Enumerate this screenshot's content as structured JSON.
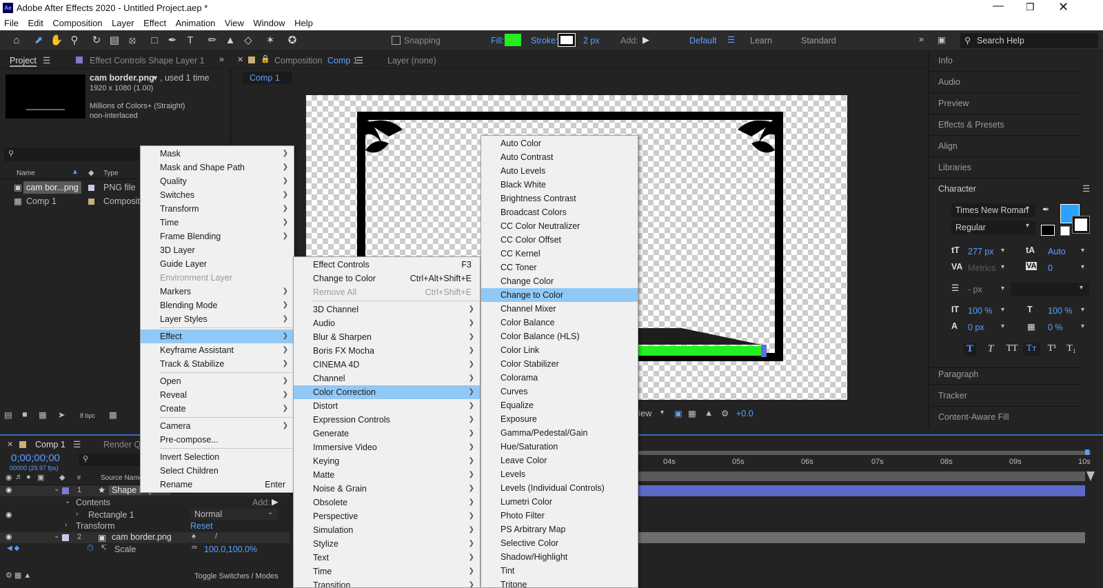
{
  "title": "Adobe After Effects 2020 - Untitled Project.aep *",
  "menubar": [
    "File",
    "Edit",
    "Composition",
    "Layer",
    "Effect",
    "Animation",
    "View",
    "Window",
    "Help"
  ],
  "toolbar": {
    "snapping": "Snapping",
    "fill_label": "Fill:",
    "fill_color": "#22ee22",
    "stroke_label": "Stroke:",
    "stroke_px": "2 px",
    "add_label": "Add:",
    "workspace_default": "Default",
    "workspace_learn": "Learn",
    "workspace_standard": "Standard",
    "search_placeholder": "Search Help"
  },
  "project": {
    "tab_project": "Project",
    "tab_effect_controls": "Effect Controls Shape Layer 1",
    "asset_name": "cam border.png",
    "asset_used": ", used 1 time",
    "asset_dims": "1920 x 1080 (1.00)",
    "asset_colors": "Millions of Colors+ (Straight)",
    "asset_interlace": "non-interlaced",
    "col_name": "Name",
    "col_type": "Type",
    "items": [
      {
        "name": "cam bor...png",
        "type": "PNG file"
      },
      {
        "name": "Comp 1",
        "type": "Composit"
      }
    ],
    "bpc": "8 bpc"
  },
  "composition": {
    "tab_label": "Composition",
    "tab_comp": "Comp 1",
    "layer_tab": "Layer  (none)",
    "sub_tab": "Comp 1",
    "view_label": "1 View",
    "exposure": "+0.0"
  },
  "right_panel": {
    "items_top": [
      "Info",
      "Audio",
      "Preview",
      "Effects & Presets",
      "Align",
      "Libraries"
    ],
    "character": "Character",
    "font": "Times New Roman",
    "style": "Regular",
    "size": "277 px",
    "leading": "Auto",
    "kerning": "Metrics",
    "tracking": "0",
    "stroke_px": "- px",
    "vscale": "100 %",
    "hscale": "100 %",
    "baseline": "0 px",
    "tsume": "0 %",
    "fill_swatch": "#29a3ff",
    "items_bottom": [
      "Paragraph",
      "Tracker",
      "Content-Aware Fill"
    ]
  },
  "timeline": {
    "tab_comp": "Comp 1",
    "tab_render": "Render Qu",
    "timecode": "0;00;00;00",
    "fps": "00000 (29.97 fps)",
    "source_name": "Source Name",
    "layers": [
      {
        "num": "1",
        "name": "Shape Layer 1"
      },
      {
        "num": "2",
        "name": "cam border.png"
      }
    ],
    "contents": "Contents",
    "add": "Add:",
    "rectangle": "Rectangle 1",
    "blend_mode": "Normal",
    "transform": "Transform",
    "reset": "Reset",
    "scale_label": "Scale",
    "scale_value": "100.0,100.0%",
    "ruler": [
      "04s",
      "05s",
      "06s",
      "07s",
      "08s",
      "09s",
      "10s"
    ],
    "toggle": "Toggle Switches / Modes"
  },
  "context_menu": [
    {
      "label": "Mask",
      "sub": true
    },
    {
      "label": "Mask and Shape Path",
      "sub": true
    },
    {
      "label": "Quality",
      "sub": true
    },
    {
      "label": "Switches",
      "sub": true
    },
    {
      "label": "Transform",
      "sub": true
    },
    {
      "label": "Time",
      "sub": true
    },
    {
      "label": "Frame Blending",
      "sub": true
    },
    {
      "label": "3D Layer"
    },
    {
      "label": "Guide Layer"
    },
    {
      "label": "Environment Layer",
      "disabled": true
    },
    {
      "label": "Markers",
      "sub": true
    },
    {
      "label": "Blending Mode",
      "sub": true
    },
    {
      "label": "Layer Styles",
      "sub": true
    },
    {
      "sep": true
    },
    {
      "label": "Effect",
      "sub": true,
      "highlight": true
    },
    {
      "label": "Keyframe Assistant",
      "sub": true
    },
    {
      "label": "Track & Stabilize",
      "sub": true
    },
    {
      "sep": true
    },
    {
      "label": "Open",
      "sub": true
    },
    {
      "label": "Reveal",
      "sub": true
    },
    {
      "label": "Create",
      "sub": true
    },
    {
      "sep": true
    },
    {
      "label": "Camera",
      "sub": true
    },
    {
      "label": "Pre-compose..."
    },
    {
      "sep": true
    },
    {
      "label": "Invert Selection"
    },
    {
      "label": "Select Children"
    },
    {
      "label": "Rename",
      "shortcut": "Enter"
    }
  ],
  "effect_menu": [
    {
      "label": "Effect Controls",
      "shortcut": "F3"
    },
    {
      "label": "Change to Color",
      "shortcut": "Ctrl+Alt+Shift+E"
    },
    {
      "label": "Remove All",
      "shortcut": "Ctrl+Shift+E",
      "disabled": true
    },
    {
      "sep": true
    },
    {
      "label": "3D Channel",
      "sub": true
    },
    {
      "label": "Audio",
      "sub": true
    },
    {
      "label": "Blur & Sharpen",
      "sub": true
    },
    {
      "label": "Boris FX Mocha",
      "sub": true
    },
    {
      "label": "CINEMA 4D",
      "sub": true
    },
    {
      "label": "Channel",
      "sub": true
    },
    {
      "label": "Color Correction",
      "sub": true,
      "highlight": true
    },
    {
      "label": "Distort",
      "sub": true
    },
    {
      "label": "Expression Controls",
      "sub": true
    },
    {
      "label": "Generate",
      "sub": true
    },
    {
      "label": "Immersive Video",
      "sub": true
    },
    {
      "label": "Keying",
      "sub": true
    },
    {
      "label": "Matte",
      "sub": true
    },
    {
      "label": "Noise & Grain",
      "sub": true
    },
    {
      "label": "Obsolete",
      "sub": true
    },
    {
      "label": "Perspective",
      "sub": true
    },
    {
      "label": "Simulation",
      "sub": true
    },
    {
      "label": "Stylize",
      "sub": true
    },
    {
      "label": "Text",
      "sub": true
    },
    {
      "label": "Time",
      "sub": true
    },
    {
      "label": "Transition",
      "sub": true
    }
  ],
  "color_menu": [
    {
      "label": "Auto Color"
    },
    {
      "label": "Auto Contrast"
    },
    {
      "label": "Auto Levels"
    },
    {
      "label": "Black  White"
    },
    {
      "label": "Brightness  Contrast"
    },
    {
      "label": "Broadcast Colors"
    },
    {
      "label": "CC Color Neutralizer"
    },
    {
      "label": "CC Color Offset"
    },
    {
      "label": "CC Kernel"
    },
    {
      "label": "CC Toner"
    },
    {
      "label": "Change Color"
    },
    {
      "label": "Change to Color",
      "highlight": true
    },
    {
      "label": "Channel Mixer"
    },
    {
      "label": "Color Balance"
    },
    {
      "label": "Color Balance (HLS)"
    },
    {
      "label": "Color Link"
    },
    {
      "label": "Color Stabilizer"
    },
    {
      "label": "Colorama"
    },
    {
      "label": "Curves"
    },
    {
      "label": "Equalize"
    },
    {
      "label": "Exposure"
    },
    {
      "label": "Gamma/Pedestal/Gain"
    },
    {
      "label": "Hue/Saturation"
    },
    {
      "label": "Leave Color"
    },
    {
      "label": "Levels"
    },
    {
      "label": "Levels (Individual Controls)"
    },
    {
      "label": "Lumetri Color"
    },
    {
      "label": "Photo Filter"
    },
    {
      "label": "PS Arbitrary Map"
    },
    {
      "label": "Selective Color"
    },
    {
      "label": "Shadow/Highlight"
    },
    {
      "label": "Tint"
    },
    {
      "label": "Tritone"
    }
  ]
}
